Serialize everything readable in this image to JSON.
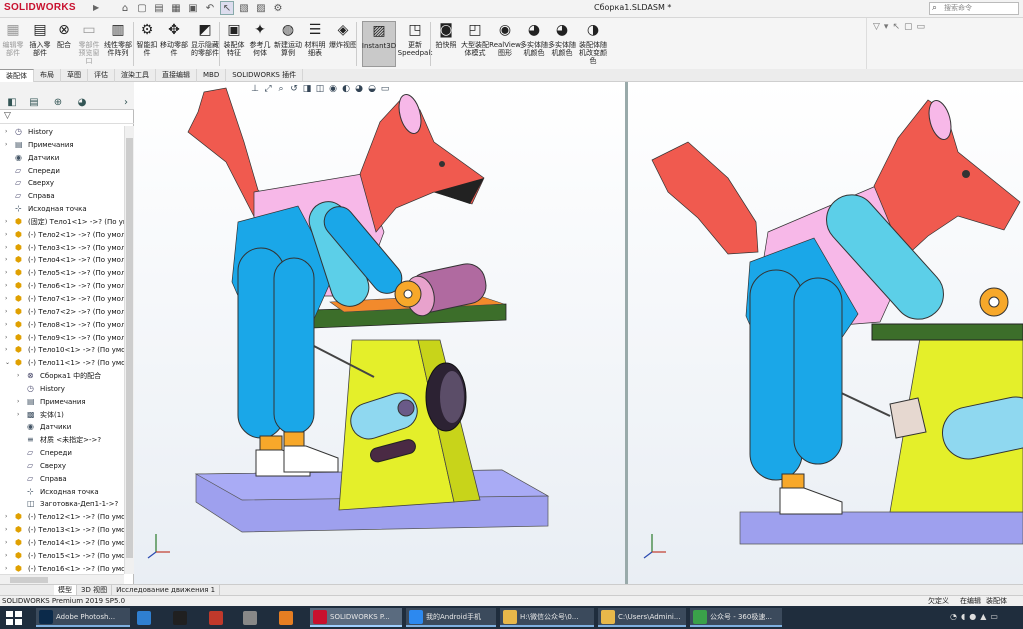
{
  "app": {
    "logo": "SOLIDWORKS",
    "window_title": "Сборка1.SLDASM *",
    "search_placeholder": "搜索命令"
  },
  "ribbon": {
    "buttons": [
      {
        "label": "编辑零部件",
        "icon": "edit-component-icon",
        "disabled": true
      },
      {
        "label": "插入零部件",
        "icon": "insert-component-icon",
        "disabled": false
      },
      {
        "label": "配合",
        "icon": "mate-icon",
        "disabled": false
      },
      {
        "label": "零部件预览窗口",
        "icon": "component-preview-icon",
        "disabled": true
      },
      {
        "label": "线性零部件阵列",
        "icon": "linear-pattern-icon",
        "disabled": false
      },
      {
        "label": "智能扣件",
        "icon": "smart-fastener-icon",
        "disabled": false
      },
      {
        "label": "移动零部件",
        "icon": "move-component-icon",
        "disabled": false
      },
      {
        "label": "显示隐藏的零部件",
        "icon": "show-hidden-icon",
        "disabled": false
      },
      {
        "label": "装配体特征",
        "icon": "assembly-feature-icon",
        "disabled": false
      },
      {
        "label": "参考几何体",
        "icon": "reference-geometry-icon",
        "disabled": false
      },
      {
        "label": "新建运动算例",
        "icon": "motion-study-icon",
        "disabled": false
      },
      {
        "label": "材料明细表",
        "icon": "bom-icon",
        "disabled": false
      },
      {
        "label": "爆炸视图",
        "icon": "exploded-view-icon",
        "disabled": false
      },
      {
        "label": "Instant3D",
        "icon": "instant3d-icon",
        "disabled": false,
        "active": true
      },
      {
        "label": "更新Speedpak",
        "icon": "speedpak-icon",
        "disabled": false
      },
      {
        "label": "拍快照",
        "icon": "snapshot-icon",
        "disabled": false
      },
      {
        "label": "大型装配体模式",
        "icon": "large-assembly-icon",
        "disabled": false
      },
      {
        "label": "RealView图形",
        "icon": "realview-icon",
        "disabled": false
      },
      {
        "label": "多实体随机颜色",
        "icon": "random-color-icon",
        "disabled": false
      },
      {
        "label": "多实体随机颜色",
        "icon": "random-color-icon-2",
        "disabled": false
      },
      {
        "label": "装配体随机改变颜色",
        "icon": "assembly-random-color-icon",
        "disabled": false
      }
    ]
  },
  "command_tabs": [
    "装配体",
    "布局",
    "草图",
    "评估",
    "渲染工具",
    "直接编辑",
    "MBD",
    "SOLIDWORKS 插件"
  ],
  "feature_tree": {
    "items": [
      {
        "label": "History",
        "icon": "history-icon",
        "indent": 1,
        "exp": "›"
      },
      {
        "label": "Примечания",
        "icon": "annotations-icon",
        "indent": 1,
        "exp": "›"
      },
      {
        "label": "Датчики",
        "icon": "sensors-icon",
        "indent": 1,
        "exp": ""
      },
      {
        "label": "Спереди",
        "icon": "plane-icon",
        "indent": 1,
        "exp": ""
      },
      {
        "label": "Сверху",
        "icon": "plane-icon",
        "indent": 1,
        "exp": ""
      },
      {
        "label": "Справа",
        "icon": "plane-icon",
        "indent": 1,
        "exp": ""
      },
      {
        "label": "Исходная точка",
        "icon": "origin-icon",
        "indent": 1,
        "exp": ""
      },
      {
        "label": "(固定) Тело1<1> ->? (По ум",
        "icon": "part-icon",
        "indent": 1,
        "exp": "›"
      },
      {
        "label": "(-) Тело2<1> ->? (По умол",
        "icon": "part-icon",
        "indent": 1,
        "exp": "›"
      },
      {
        "label": "(-) Тело3<1> ->? (По умол",
        "icon": "part-icon",
        "indent": 1,
        "exp": "›"
      },
      {
        "label": "(-) Тело4<1> ->? (По умол",
        "icon": "part-icon",
        "indent": 1,
        "exp": "›"
      },
      {
        "label": "(-) Тело5<1> ->? (По умол",
        "icon": "part-icon",
        "indent": 1,
        "exp": "›"
      },
      {
        "label": "(-) Тело6<1> ->? (По умол",
        "icon": "part-icon",
        "indent": 1,
        "exp": "›"
      },
      {
        "label": "(-) Тело7<1> ->? (По умол",
        "icon": "part-icon",
        "indent": 1,
        "exp": "›"
      },
      {
        "label": "(-) Тело7<2> ->? (По умол",
        "icon": "part-icon",
        "indent": 1,
        "exp": "›"
      },
      {
        "label": "(-) Тело8<1> ->? (По умол",
        "icon": "part-icon",
        "indent": 1,
        "exp": "›"
      },
      {
        "label": "(-) Тело9<1> ->? (По умол",
        "icon": "part-icon",
        "indent": 1,
        "exp": "›"
      },
      {
        "label": "(-) Тело10<1> ->? (По умо",
        "icon": "part-icon",
        "indent": 1,
        "exp": "›"
      },
      {
        "label": "(-) Тело11<1> ->? (По умо",
        "icon": "part-icon",
        "indent": 1,
        "exp": "⌄"
      },
      {
        "label": "Сборка1 中的配合",
        "icon": "mates-icon",
        "indent": 2,
        "exp": "›"
      },
      {
        "label": "History",
        "icon": "history-icon",
        "indent": 2,
        "exp": ""
      },
      {
        "label": "Примечания",
        "icon": "annotations-icon",
        "indent": 2,
        "exp": "›"
      },
      {
        "label": "实体(1)",
        "icon": "solid-bodies-icon",
        "indent": 2,
        "exp": "›"
      },
      {
        "label": "Датчики",
        "icon": "sensors-icon",
        "indent": 2,
        "exp": ""
      },
      {
        "label": "材质 <未指定>->?",
        "icon": "material-icon",
        "indent": 2,
        "exp": ""
      },
      {
        "label": "Спереди",
        "icon": "plane-icon",
        "indent": 2,
        "exp": ""
      },
      {
        "label": "Сверху",
        "icon": "plane-icon",
        "indent": 2,
        "exp": ""
      },
      {
        "label": "Справа",
        "icon": "plane-icon",
        "indent": 2,
        "exp": ""
      },
      {
        "label": "Исходная точка",
        "icon": "origin-icon",
        "indent": 2,
        "exp": ""
      },
      {
        "label": "Заготовка-Деп1-1->?",
        "icon": "extrude-icon",
        "indent": 2,
        "exp": ""
      },
      {
        "label": "(-) Тело12<1> ->? (По умо",
        "icon": "part-icon",
        "indent": 1,
        "exp": "›"
      },
      {
        "label": "(-) Тело13<1> ->? (По умо",
        "icon": "part-icon",
        "indent": 1,
        "exp": "›"
      },
      {
        "label": "(-) Тело14<1> ->? (По умо",
        "icon": "part-icon",
        "indent": 1,
        "exp": "›"
      },
      {
        "label": "(-) Тело15<1> ->? (По умо",
        "icon": "part-icon",
        "indent": 1,
        "exp": "›"
      },
      {
        "label": "(-) Тело16<1> ->? (По умо",
        "icon": "part-icon",
        "indent": 1,
        "exp": "›"
      }
    ]
  },
  "bottom_tabs": [
    "模型",
    "3D 视图",
    "Исследование движения 1"
  ],
  "status": {
    "product": "SOLIDWORKS Premium 2019 SP5.0",
    "undefined": "欠定义",
    "editing": "在编辑",
    "doc_type": "装配体"
  },
  "taskbar": {
    "items": [
      {
        "label": "Adobe Photosh...",
        "icon": "photoshop-icon",
        "color": "#0b2a4a"
      },
      {
        "label": "",
        "icon": "app-icon-1",
        "color": "#2f7fd0"
      },
      {
        "label": "",
        "icon": "app-icon-2",
        "color": "#202020"
      },
      {
        "label": "",
        "icon": "app-icon-3",
        "color": "#c0392b"
      },
      {
        "label": "",
        "icon": "app-icon-4",
        "color": "#888888"
      },
      {
        "label": "",
        "icon": "browser-icon",
        "color": "#e67e22"
      },
      {
        "label": "SOLIDWORKS P...",
        "icon": "solidworks-icon",
        "color": "#c8102e"
      },
      {
        "label": "我的Android手机",
        "icon": "phone-icon",
        "color": "#2d89ef"
      },
      {
        "label": "H:\\微信公众号\\0...",
        "icon": "folder-icon",
        "color": "#e8b84a"
      },
      {
        "label": "C:\\Users\\Admini...",
        "icon": "folder-icon-2",
        "color": "#e8b84a"
      },
      {
        "label": "公众号 - 360极速...",
        "icon": "browser-360-icon",
        "color": "#3aa14a"
      }
    ]
  },
  "colors": {
    "accent": "#c8102e",
    "fox_red": "#f05a4f",
    "fox_pink": "#f7b8e8",
    "fox_blue": "#1aa7e8",
    "arm_cyan": "#5ccfe8",
    "stand_yellow": "#e4ef2a",
    "table_green": "#3c6e2a",
    "base_lavender": "#9ea0ee",
    "roller_purple": "#b06aa0"
  }
}
